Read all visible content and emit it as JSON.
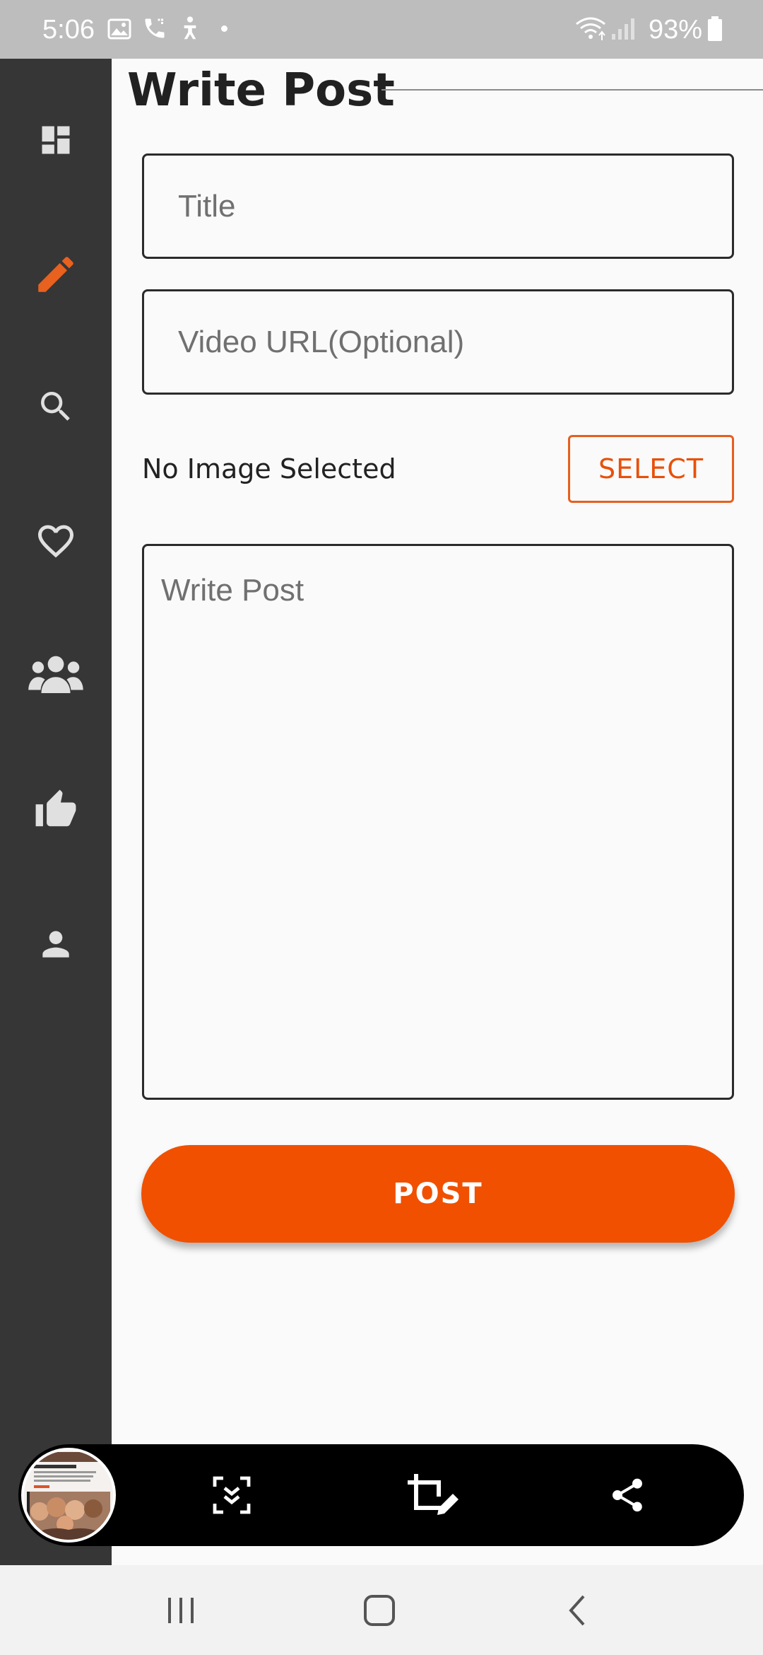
{
  "status_bar": {
    "time": "5:06",
    "battery_percent": "93%",
    "icons": [
      "gallery-icon",
      "phone-call-icon",
      "accessibility-icon",
      "dot-icon",
      "wifi-icon",
      "signal-icon",
      "battery-icon"
    ]
  },
  "sidebar": {
    "items": [
      {
        "name": "dashboard",
        "icon": "dashboard-icon",
        "active": false
      },
      {
        "name": "write",
        "icon": "pencil-icon",
        "active": true
      },
      {
        "name": "search",
        "icon": "search-icon",
        "active": false
      },
      {
        "name": "favorites",
        "icon": "heart-icon",
        "active": false
      },
      {
        "name": "groups",
        "icon": "people-icon",
        "active": false
      },
      {
        "name": "likes",
        "icon": "thumbs-up-icon",
        "active": false
      },
      {
        "name": "profile",
        "icon": "person-icon",
        "active": false
      }
    ],
    "active_color": "#e8611e",
    "icon_color": "#e0e0e0",
    "background": "#363636"
  },
  "header": {
    "title": "Write Post"
  },
  "form": {
    "title_placeholder": "Title",
    "title_value": "",
    "video_url_placeholder": "Video URL(Optional)",
    "video_url_value": "",
    "image_status": "No Image Selected",
    "select_label": "SELECT",
    "post_placeholder": "Write Post",
    "post_value": "",
    "submit_label": "POST"
  },
  "colors": {
    "accent": "#f05000",
    "background": "#fafafa",
    "text": "#212121"
  },
  "capture_toolbar": {
    "tools": [
      "scroll-capture-icon",
      "crop-edit-icon",
      "share-icon"
    ]
  },
  "nav_bar": {
    "buttons": [
      "recents-icon",
      "home-icon",
      "back-icon"
    ]
  }
}
